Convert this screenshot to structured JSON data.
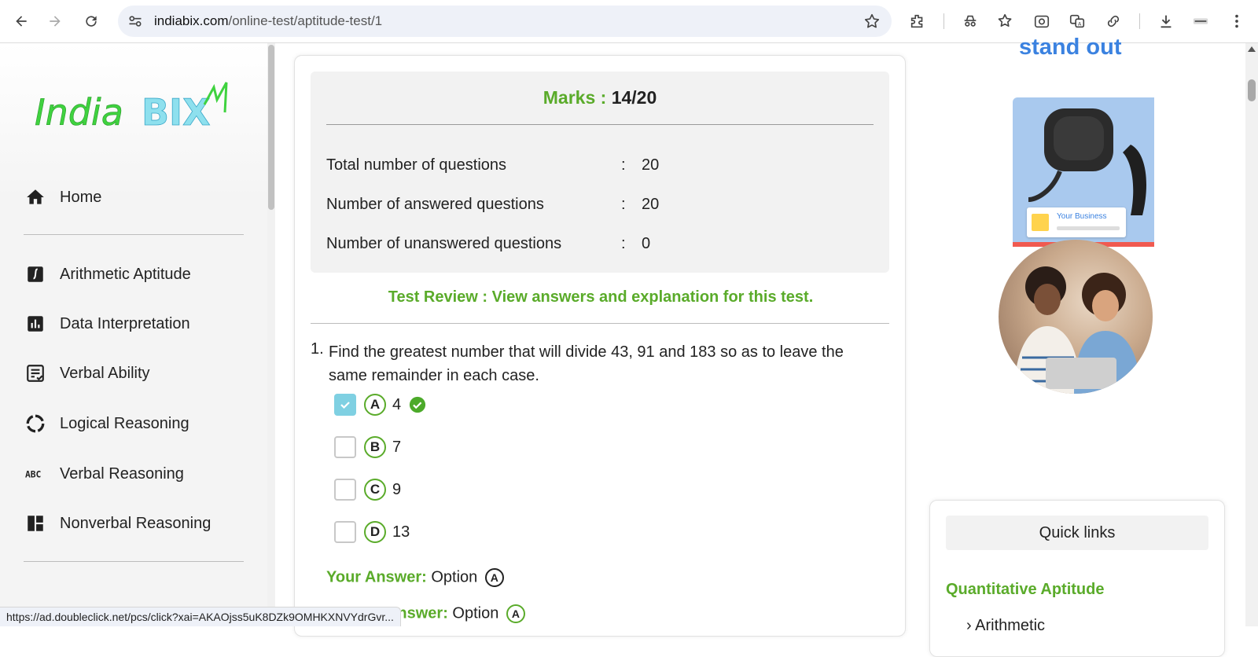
{
  "browser": {
    "url_host": "indiabix.com",
    "url_path": "/online-test/aptitude-test/1"
  },
  "sidebar": {
    "logo_text": "IndiaBIX",
    "items": [
      {
        "label": "Home",
        "icon": "home-icon"
      },
      {
        "label": "Arithmetic Aptitude",
        "icon": "integral-icon"
      },
      {
        "label": "Data Interpretation",
        "icon": "bar-chart-icon"
      },
      {
        "label": "Verbal Ability",
        "icon": "document-check-icon"
      },
      {
        "label": "Logical Reasoning",
        "icon": "circle-arrows-icon"
      },
      {
        "label": "Verbal Reasoning",
        "icon": "abc-icon"
      },
      {
        "label": "Nonverbal Reasoning",
        "icon": "dashboard-icon"
      }
    ]
  },
  "summary": {
    "marks_label": "Marks :",
    "marks_value": "14/20",
    "rows": [
      {
        "label": "Total number of questions",
        "sep": ":",
        "value": "20"
      },
      {
        "label": "Number of answered questions",
        "sep": ":",
        "value": "20"
      },
      {
        "label": "Number of unanswered questions",
        "sep": ":",
        "value": "0"
      }
    ],
    "review_text": "Test Review : View answers and explanation for this test."
  },
  "question": {
    "number": "1.",
    "text": "Find the greatest number that will divide 43, 91 and 183 so as to leave the same remainder in each case.",
    "options": [
      {
        "letter": "A",
        "value": "4",
        "checked": true,
        "correct": true
      },
      {
        "letter": "B",
        "value": "7",
        "checked": false,
        "correct": false
      },
      {
        "letter": "C",
        "value": "9",
        "checked": false,
        "correct": false
      },
      {
        "letter": "D",
        "value": "13",
        "checked": false,
        "correct": false
      }
    ],
    "your_answer_label": "Your Answer:",
    "your_answer_text": "Option",
    "your_answer_letter": "A",
    "correct_answer_label": "Correct Answer:",
    "correct_answer_text": "Option",
    "correct_answer_letter": "A"
  },
  "ad": {
    "headline": "stand out",
    "tag_text": "Your Business"
  },
  "quick_links": {
    "title": "Quick links",
    "section": "Quantitative Aptitude",
    "item": "Arithmetic"
  },
  "status_bar": {
    "text": "https://ad.doubleclick.net/pcs/click?xai=AKAOjss5uK8DZk9OMHKXNVYdrGvr..."
  },
  "colors": {
    "accent_green": "#5aab2a",
    "check_blue": "#7fd0e2",
    "ad_blue": "#3b82e0"
  }
}
